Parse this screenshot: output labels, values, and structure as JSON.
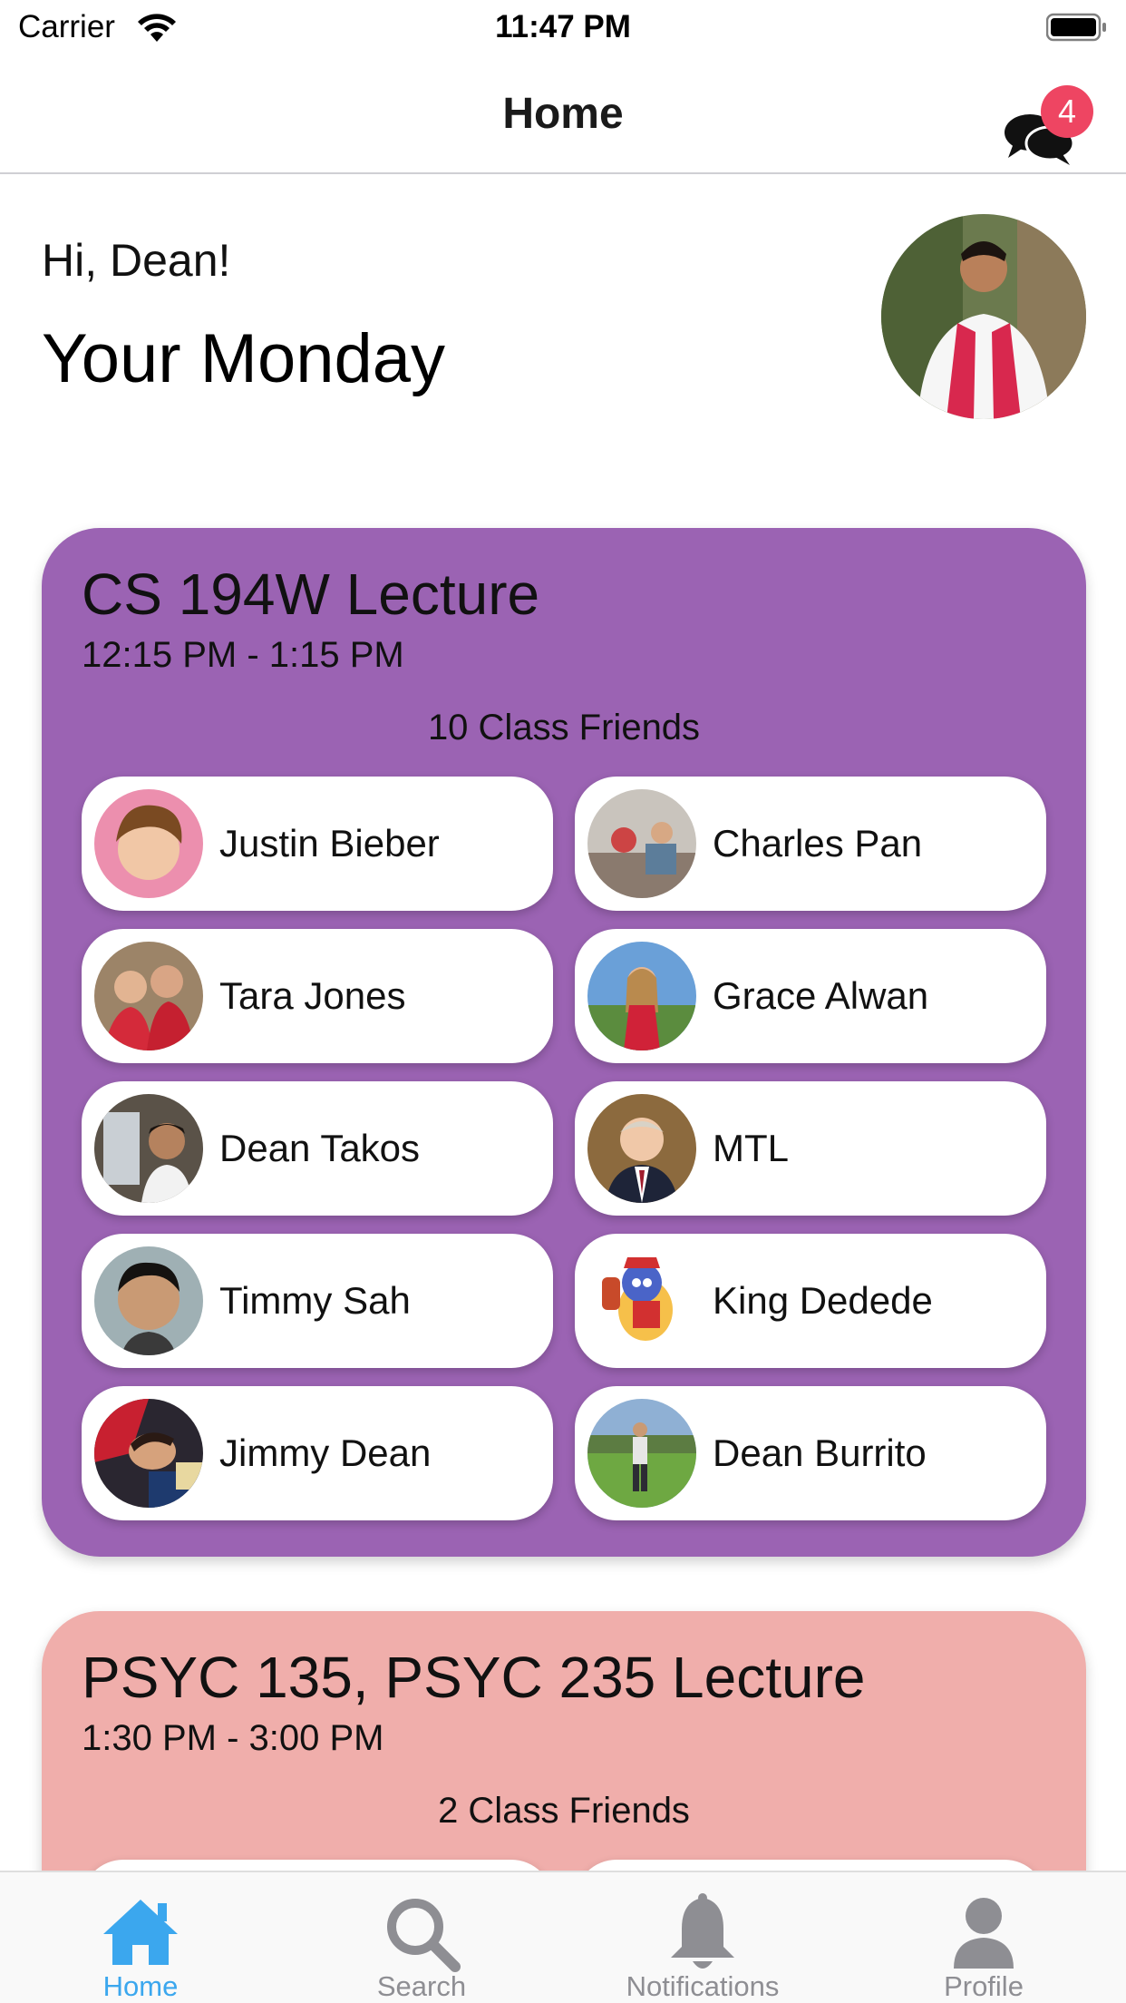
{
  "status_bar": {
    "carrier": "Carrier",
    "time": "11:47 PM"
  },
  "nav": {
    "title": "Home",
    "chat_badge": "4"
  },
  "greeting": {
    "hello": "Hi, Dean!",
    "day": "Your Monday"
  },
  "colors": {
    "accent": "#3ba7ee",
    "badge": "#ee4562",
    "card1": "#9b63b3",
    "card2": "#f0aeab",
    "tab_inactive": "#8e8e93"
  },
  "classes": [
    {
      "title": "CS 194W Lecture",
      "time": "12:15 PM - 1:15 PM",
      "friends_count": "10 Class Friends",
      "friends": [
        {
          "name": "Justin Bieber"
        },
        {
          "name": "Charles Pan"
        },
        {
          "name": "Tara Jones"
        },
        {
          "name": "Grace Alwan"
        },
        {
          "name": "Dean Takos"
        },
        {
          "name": "MTL"
        },
        {
          "name": "Timmy Sah"
        },
        {
          "name": "King Dedede"
        },
        {
          "name": "Jimmy Dean"
        },
        {
          "name": "Dean Burrito"
        }
      ]
    },
    {
      "title": "PSYC 135, PSYC 235 Lecture",
      "time": "1:30 PM - 3:00 PM",
      "friends_count": "2 Class Friends"
    }
  ],
  "tabs": [
    {
      "label": "Home",
      "icon": "home-icon",
      "selected": true
    },
    {
      "label": "Search",
      "icon": "search-icon",
      "selected": false
    },
    {
      "label": "Notifications",
      "icon": "bell-icon",
      "selected": false
    },
    {
      "label": "Profile",
      "icon": "person-icon",
      "selected": false
    }
  ]
}
